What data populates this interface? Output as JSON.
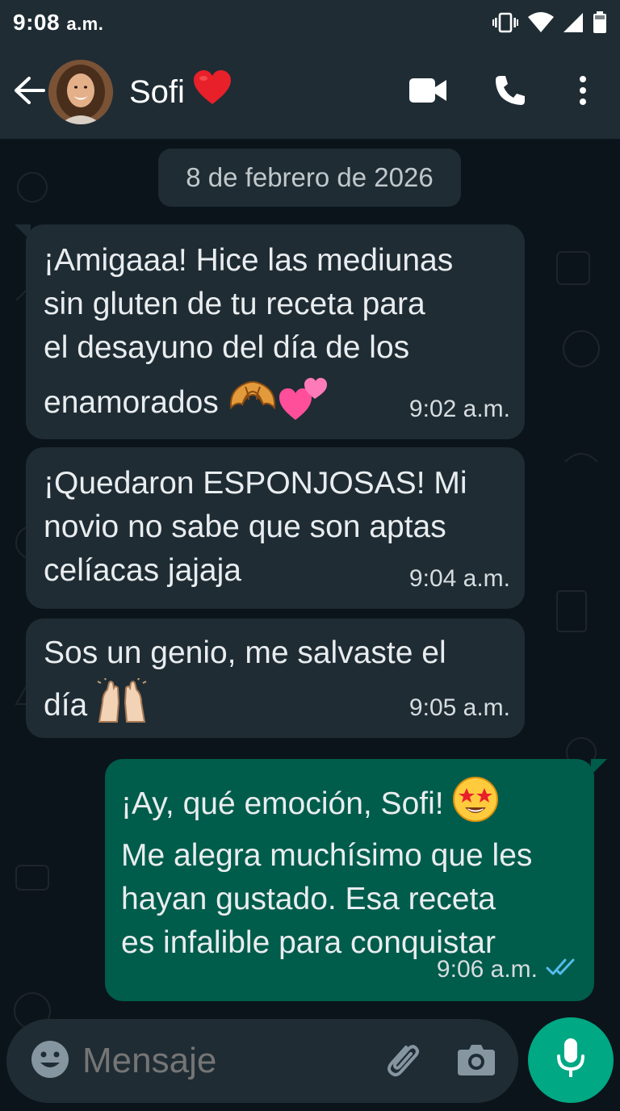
{
  "status_bar": {
    "time": "9:08",
    "ampm": "a.m."
  },
  "header": {
    "contact_name": "Sofi",
    "name_emoji": "heart",
    "icons": [
      "back-arrow-icon",
      "video-call-icon",
      "phone-icon",
      "more-options-icon"
    ]
  },
  "date_separator": "8 de febrero de 2026",
  "messages": [
    {
      "direction": "incoming",
      "lines": [
        "¡Amigaaa! Hice las mediunas",
        "sin gluten de tu receta para",
        "el desayuno del día de los",
        "enamorados"
      ],
      "emojis": [
        "croissant",
        "two-hearts"
      ],
      "time": "9:02 a.m."
    },
    {
      "direction": "incoming",
      "lines": [
        "¡Quedaron ESPONJOSAS! Mi",
        "novio no sabe que son aptas",
        "celíacas jajaja"
      ],
      "time": "9:04 a.m."
    },
    {
      "direction": "incoming",
      "lines": [
        "Sos un genio, me salvaste el",
        "día"
      ],
      "emojis": [
        "raising-hands"
      ],
      "time": "9:05 a.m."
    },
    {
      "direction": "outgoing",
      "lines": [
        "¡Ay, qué emoción, Sofi!",
        "Me alegra muchísimo que les",
        "hayan gustado. Esa receta",
        "es infalible para conquistar"
      ],
      "emojis": [
        "star-struck"
      ],
      "time": "9:06 a.m.",
      "status": "read"
    }
  ],
  "input": {
    "placeholder": "Mensaje"
  },
  "colors": {
    "header_bg": "#1f2c34",
    "chat_bg": "#0b141a",
    "incoming_bubble": "#1f2c34",
    "outgoing_bubble": "#005c4b",
    "accent": "#00a884",
    "read_ticks": "#53bdeb"
  }
}
